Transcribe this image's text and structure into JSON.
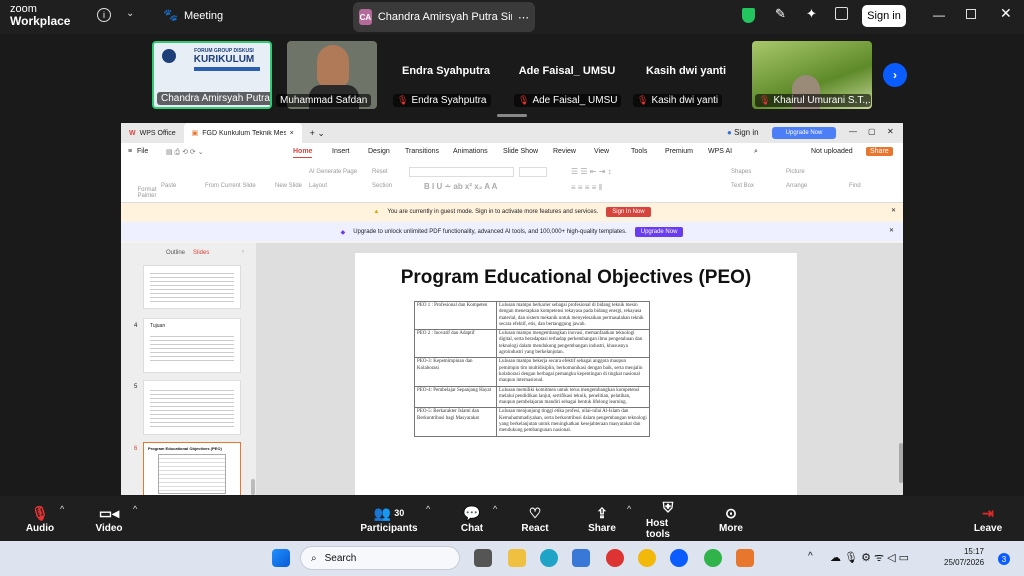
{
  "app": {
    "brand_top": "zoom",
    "brand_bottom": "Workplace",
    "meeting_label": "Meeting",
    "sign_in": "Sign in"
  },
  "speaker_tab": {
    "initials": "CA",
    "name": "Chandra Amirsyah Putra Siregar..."
  },
  "participants_strip": [
    {
      "name": "Chandra Amirsyah Putra...",
      "muted": false,
      "kind": "share"
    },
    {
      "name": "Muhammad Safdan",
      "muted": false,
      "kind": "video"
    },
    {
      "name": "Endra Syahputra",
      "muted": true,
      "kind": "name",
      "big": "Endra Syahputra"
    },
    {
      "name": "Ade Faisal_ UMSU",
      "muted": true,
      "kind": "name",
      "big": "Ade Faisal_ UMSU"
    },
    {
      "name": "Kasih dwi yanti",
      "muted": true,
      "kind": "name",
      "big": "Kasih dwi yanti"
    },
    {
      "name": "Khairul Umurani S.T.,...",
      "muted": true,
      "kind": "video"
    }
  ],
  "wps": {
    "tabs": [
      "WPS Office",
      "FGD Kurikulum Teknik Mes"
    ],
    "sign_in": "Sign in",
    "upgrade_now": "Upgrade Now",
    "menu": [
      "File",
      "Home",
      "Insert",
      "Design",
      "Transitions",
      "Animations",
      "Slide Show",
      "Review",
      "View",
      "Tools",
      "Premium",
      "WPS AI"
    ],
    "menu_active": "Home",
    "not_uploaded": "Not uploaded",
    "share": "Share",
    "ribbon": [
      "Format Painter",
      "Paste",
      "From Current Slide",
      "New Slide",
      "AI Generate Page",
      "Layout",
      "Reset",
      "Section",
      "Shapes",
      "Picture",
      "Find",
      "Text Box",
      "Arrange"
    ],
    "guest_msg": "You are currently in guest mode. Sign in to activate more features and services.",
    "guest_btn": "Sign In Now",
    "upgrade_msg": "Upgrade to unlock unlimited PDF functionality, advanced AI tools, and 100,000+ high-quality templates.",
    "upgrade_btn": "Upgrade Now",
    "panel_tabs": [
      "Outline",
      "Slides"
    ],
    "slide_numbers": [
      "4",
      "5",
      "6"
    ],
    "thumb4_title": "Tujuan",
    "thumb6_title": "Program Educational Objectives (PEO)"
  },
  "slide": {
    "title": "Program Educational Objectives (PEO)",
    "rows": [
      {
        "peo": "PEO 1 : Profesional dan Kompeten",
        "desc": "Lulusan mampu berkarier sebagai profesional di bidang teknik mesin dengan menerapkan kompetensi rekayasa pada bidang energi, rekayasa material, dan sistem mekanik untuk menyelesaikan permasalahan teknik secara efektif, etis, dan bertanggung jawab."
      },
      {
        "peo": "PEO 2 : Inovatif dan Adaptif",
        "desc": "Lulusan mampu mengembangkan inovasi, memanfaatkan teknologi digital, serta beradaptasi terhadap perkembangan ilmu pengetahuan dan teknologi dalam mendukung pengembangan industri, khususnya agroindustri yang berkelanjutan."
      },
      {
        "peo": "PEO-3: Kepemimpinan dan Kolaborasi",
        "desc": "Lulusan mampu bekerja secara efektif sebagai anggota maupun pemimpin tim multidisiplin, berkomunikasi dengan baik, serta menjalin kolaborasi dengan berbagai pemangku kepentingan di tingkat nasional maupun internasional."
      },
      {
        "peo": "PEO-4: Pembelajar Sepanjang Hayat",
        "desc": "Lulusan memiliki komitmen untuk terus mengembangkan kompetensi melalui pendidikan lanjut, sertifikasi teknik, penelitian, pelatihan, maupun pembelajaran mandiri sebagai bentuk lifelong learning."
      },
      {
        "peo": "PEO-5: Berkarakter Islami dan Berkontribusi bagi Masyarakat",
        "desc": "Lulusan menjunjung tinggi etika profesi, nilai-nilai Al-Islam dan Kemuhammadiyahan, serta berkontribusi dalam pengembangan teknologi yang berkelanjutan untuk meningkatkan kesejahteraan masyarakat dan mendukung pembangunan nasional."
      }
    ]
  },
  "toolbar": {
    "audio": "Audio",
    "video": "Video",
    "participants": "Participants",
    "participants_count": "30",
    "chat": "Chat",
    "react": "React",
    "share": "Share",
    "host_tools": "Host tools",
    "more": "More",
    "leave": "Leave"
  },
  "taskbar": {
    "search_placeholder": "Search",
    "time": "15:17",
    "date": "25/07/2026",
    "notifications": "3"
  },
  "colors": {
    "zoom_blue": "#0b5cff",
    "wps_red": "#d7443e",
    "leave_red": "#e02828",
    "shield_green": "#22c55e"
  }
}
